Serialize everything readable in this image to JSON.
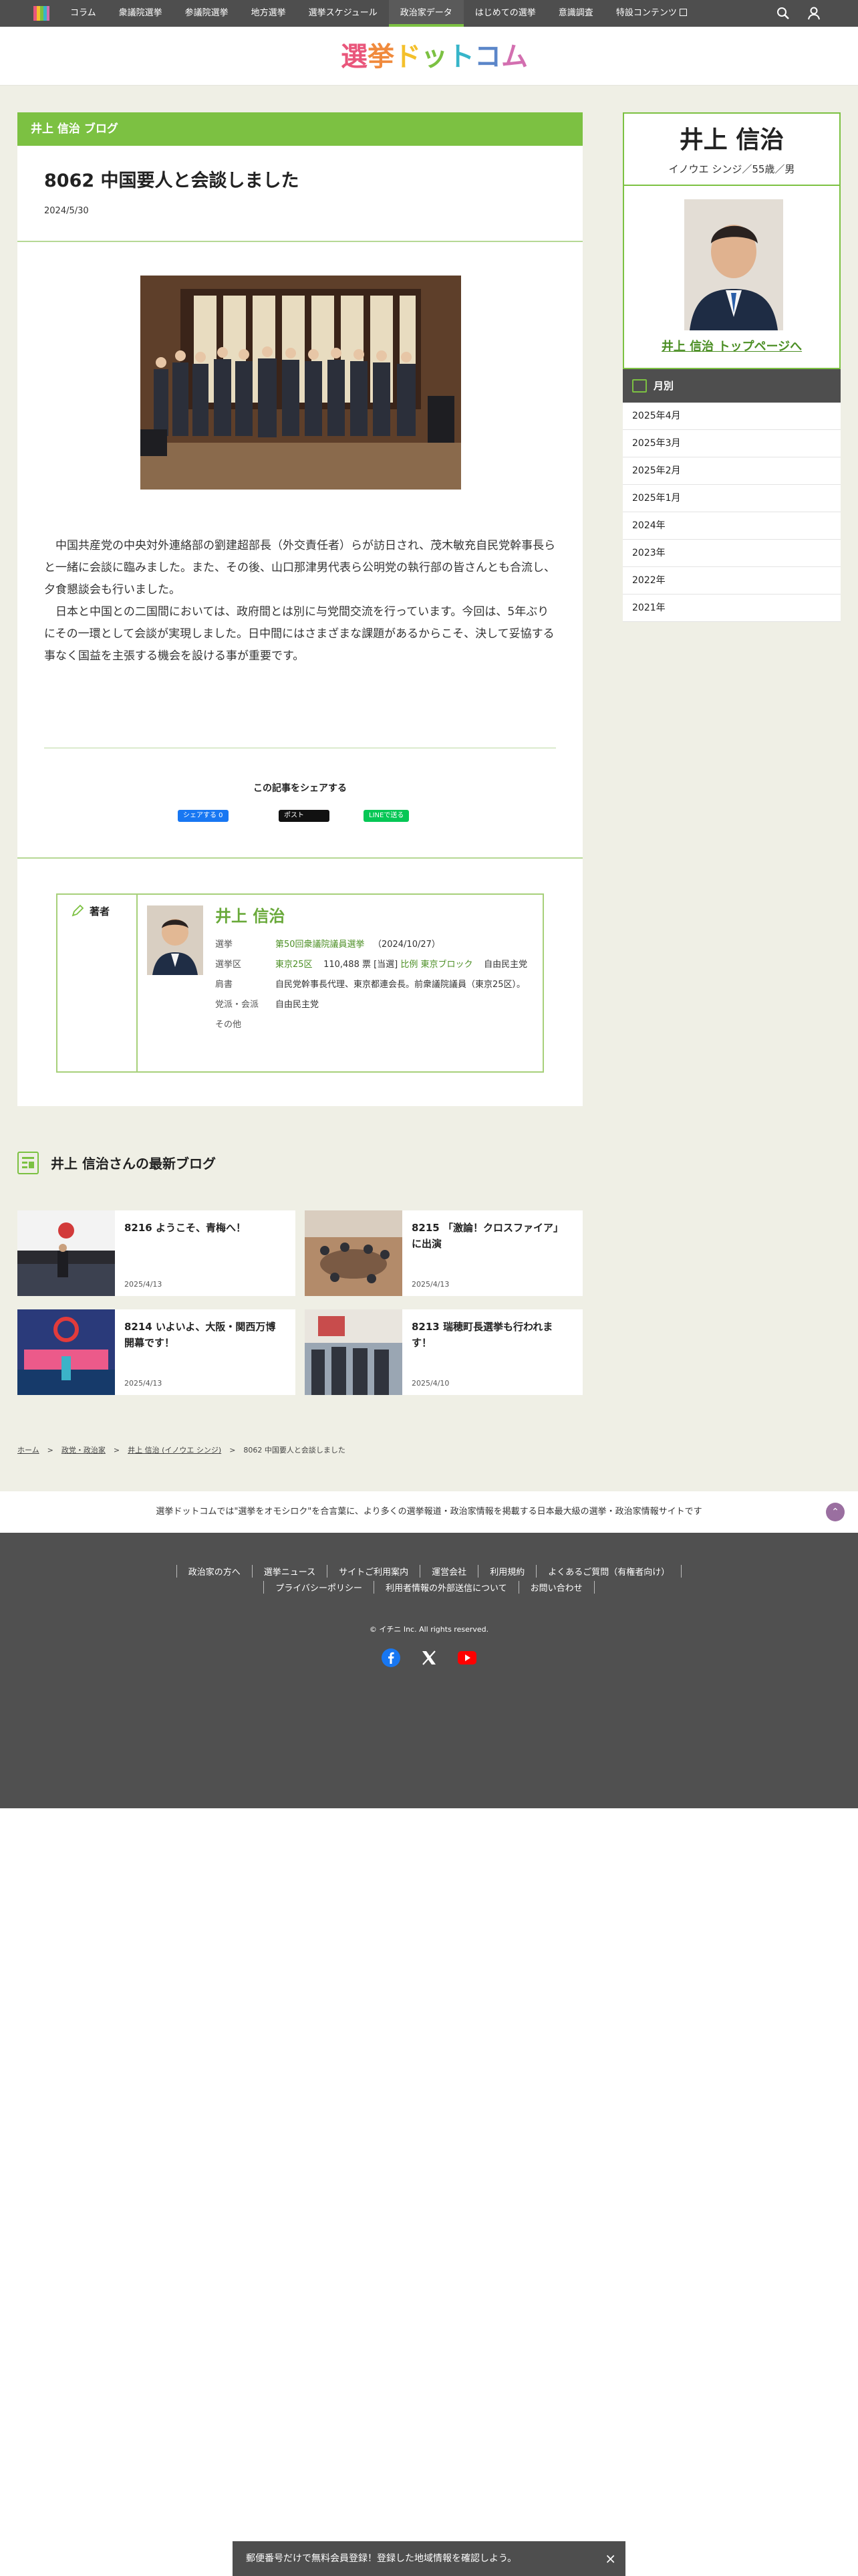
{
  "nav": {
    "items": [
      "コラム",
      "衆議院選挙",
      "参議院選挙",
      "地方選挙",
      "選挙スケジュール",
      "政治家データ",
      "はじめての選挙",
      "意識調査",
      "特設コンテンツ"
    ],
    "active_index": 5
  },
  "brand": {
    "chars": [
      {
        "t": "選",
        "c": "#e9567b"
      },
      {
        "t": "挙",
        "c": "#f08a3c"
      },
      {
        "t": "ド",
        "c": "#f4c02b"
      },
      {
        "t": "ッ",
        "c": "#7cc142"
      },
      {
        "t": "ト",
        "c": "#37b5c9"
      },
      {
        "t": "コ",
        "c": "#5b86c9"
      },
      {
        "t": "ム",
        "c": "#d36fb0"
      }
    ]
  },
  "article": {
    "section_label": "井上 信治 ブログ",
    "title": "8062 中国要人と会談しました",
    "date": "2024/5/30",
    "paragraphs": [
      "中国共産党の中央対外連絡部の劉建超部長（外交責任者）らが訪日され、茂木敏充自民党幹事長らと一緒に会談に臨みました。また、その後、山口那津男代表ら公明党の執行部の皆さんとも合流し、夕食懇談会も行いました。",
      "日本と中国との二国間においては、政府間とは別に与党間交流を行っています。今回は、5年ぶりにその一環として会談が実現しました。日中間にはさまざまな課題があるからこそ、決して妥協する事なく国益を主張する機会を設ける事が重要です。"
    ],
    "share_title": "この記事をシェアする",
    "share_buttons": {
      "facebook": "シェアする 0",
      "x": "ポスト",
      "line": "LINEで送る"
    }
  },
  "author": {
    "label": "著者",
    "name": "井上 信治",
    "rows": {
      "election_k": "選挙",
      "election_link": "第50回衆議院議員選挙",
      "election_date": "（2024/10/27）",
      "district_k": "選挙区",
      "district_link": "東京25区",
      "district_votes": "110,488 票 [当選]",
      "district_block": "比例 東京ブロック",
      "district_party": "自由民主党",
      "title_k": "肩書",
      "title_v": "自民党幹事長代理、東京都連会長。前衆議院議員（東京25区）。",
      "party_k": "党派・会派",
      "party_v": "自由民主党",
      "other_k": "その他"
    }
  },
  "latest": {
    "title": "井上 信治さんの最新ブログ",
    "posts": [
      {
        "title": "8216 ようこそ、青梅へ！",
        "date": "2025/4/13"
      },
      {
        "title": "8215 「激論！クロスファイア」に出演",
        "date": "2025/4/13"
      },
      {
        "title": "8214 いよいよ、大阪・関西万博開幕です！",
        "date": "2025/4/13"
      },
      {
        "title": "8213 瑞穂町長選挙も行われます！",
        "date": "2025/4/10"
      }
    ]
  },
  "breadcrumbs": [
    "ホーム",
    "政党・政治家",
    "井上 信治 (イノウエ シンジ)",
    "8062 中国要人と会談しました"
  ],
  "sidebar": {
    "name": "井上 信治",
    "kana": "イノウエ シンジ／55歳／男",
    "top_link": "井上 信治 トップページへ",
    "monthly_label": "月別",
    "months": [
      "2025年4月",
      "2025年3月",
      "2025年2月",
      "2025年1月",
      "2024年",
      "2023年",
      "2022年",
      "2021年"
    ]
  },
  "footer": {
    "tagline": "選挙ドットコムでは\"選挙をオモシロク\"を合言葉に、より多くの選挙報道・政治家情報を掲載する日本最大級の選挙・政治家情報サイトです",
    "links_row1": [
      "政治家の方へ",
      "選挙ニュース",
      "サイトご利用案内",
      "運営会社",
      "利用規約",
      "よくあるご質問（有権者向け）"
    ],
    "links_row2": [
      "プライバシーポリシー",
      "利用者情報の外部送信について",
      "お問い合わせ"
    ],
    "copyright": "© イチニ Inc. All rights reserved."
  },
  "bottom_banner": "郵便番号だけで無料会員登録！登録した地域情報を確認しよう。",
  "colors": {
    "accent": "#7cc142",
    "nav_bg": "#4e4e4e",
    "link": "#4c8f25"
  }
}
